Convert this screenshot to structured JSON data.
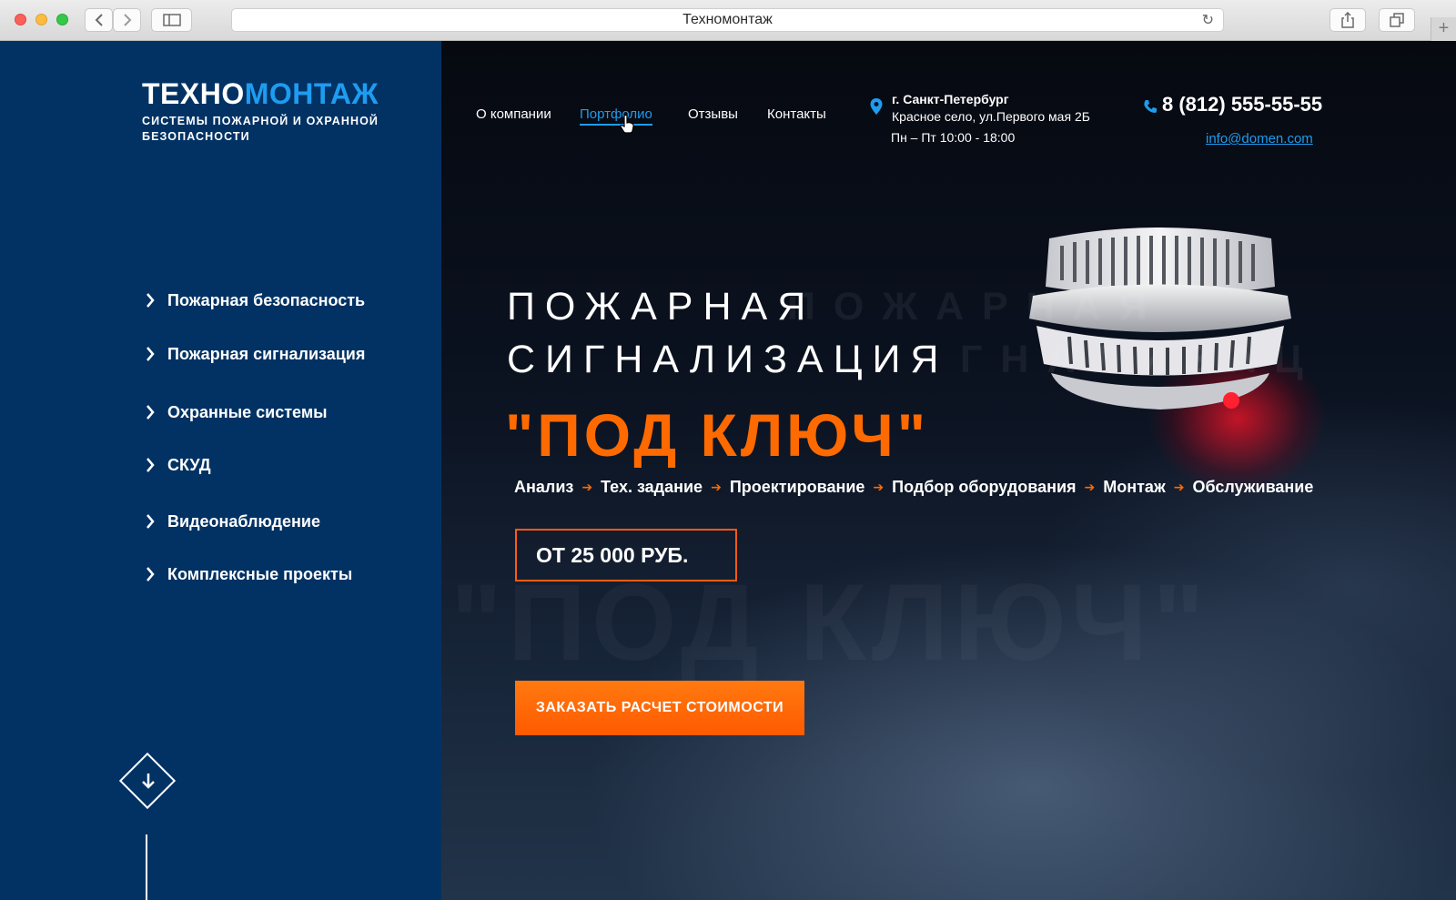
{
  "browser": {
    "tab_title": "Техномонтаж",
    "new_tab": "+"
  },
  "brand": {
    "name_part1": "ТЕХНО",
    "name_part2": "МОНТАЖ",
    "tagline": "СИСТЕМЫ ПОЖАРНОЙ И ОХРАННОЙ БЕЗОПАСНОСТИ"
  },
  "nav": {
    "items": [
      {
        "label": "О компании"
      },
      {
        "label": "Портфолио"
      },
      {
        "label": "Отзывы"
      },
      {
        "label": "Контакты"
      }
    ],
    "active": "Портфолио"
  },
  "contact": {
    "city": "г. Санкт-Петербург",
    "address": "Красное село, ул.Первого мая 2Б",
    "hours": "Пн – Пт 10:00 - 18:00",
    "phone": "8 (812) 555-55-55",
    "email": "info@domen.com"
  },
  "sidebar_menu": [
    {
      "label": "Пожарная безопасность"
    },
    {
      "label": "Пожарная сигнализация"
    },
    {
      "label": "Охранные системы"
    },
    {
      "label": "СКУД"
    },
    {
      "label": "Видеонаблюдение"
    },
    {
      "label": "Комплексные проекты"
    }
  ],
  "hero": {
    "line1": "ПОЖАРНАЯ",
    "line2": "СИГНАЛИЗАЦИЯ",
    "headline": "\"ПОД КЛЮЧ\"",
    "ghost1": "П О Ж А Р Н А Я",
    "ghost2": "Г Н А Л И З А Ц",
    "ghost3": "\"ПОД КЛЮЧ\"",
    "steps": [
      "Анализ",
      "Тех. задание",
      "Проектирование",
      "Подбор оборудования",
      "Монтаж",
      "Обслуживание"
    ],
    "price": "ОТ  25 000 РУБ.",
    "cta": "ЗАКАЗАТЬ РАСЧЕТ СТОИМОСТИ"
  },
  "colors": {
    "sidebar_bg": "#023264",
    "accent_blue": "#1e9cf0",
    "accent_orange": "#ff6a00"
  }
}
